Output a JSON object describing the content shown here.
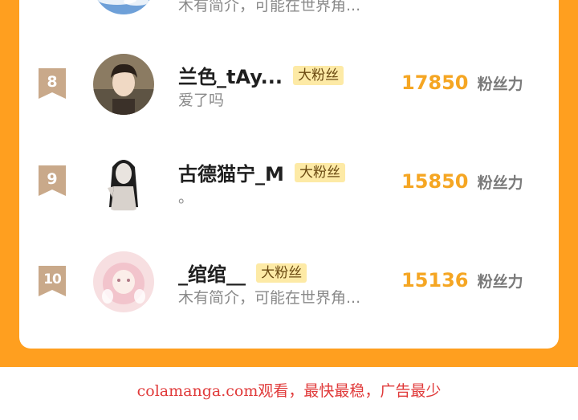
{
  "ranking": {
    "top_partial": {
      "bio": "木有简介，可能在世界角..."
    },
    "rows": [
      {
        "rank": "8",
        "name": "兰色_tAy...",
        "tag": "大粉丝",
        "bio": "爱了吗",
        "score": "17850",
        "score_unit": "粉丝力"
      },
      {
        "rank": "9",
        "name": "古德猫宁_M",
        "tag": "大粉丝",
        "bio": "。",
        "score": "15850",
        "score_unit": "粉丝力"
      },
      {
        "rank": "10",
        "name": "_绾绾__",
        "tag": "大粉丝",
        "bio": "木有简介，可能在世界角...",
        "score": "15136",
        "score_unit": "粉丝力"
      }
    ]
  },
  "footer": {
    "text": "colamanga.com观看，最快最稳，广告最少"
  },
  "colors": {
    "frame": "#ff9f1f",
    "score": "#f5a623",
    "tag_bg": "#fdeaa6",
    "rank_badge": "#c9a98a",
    "footer_text": "#e03a3a"
  }
}
